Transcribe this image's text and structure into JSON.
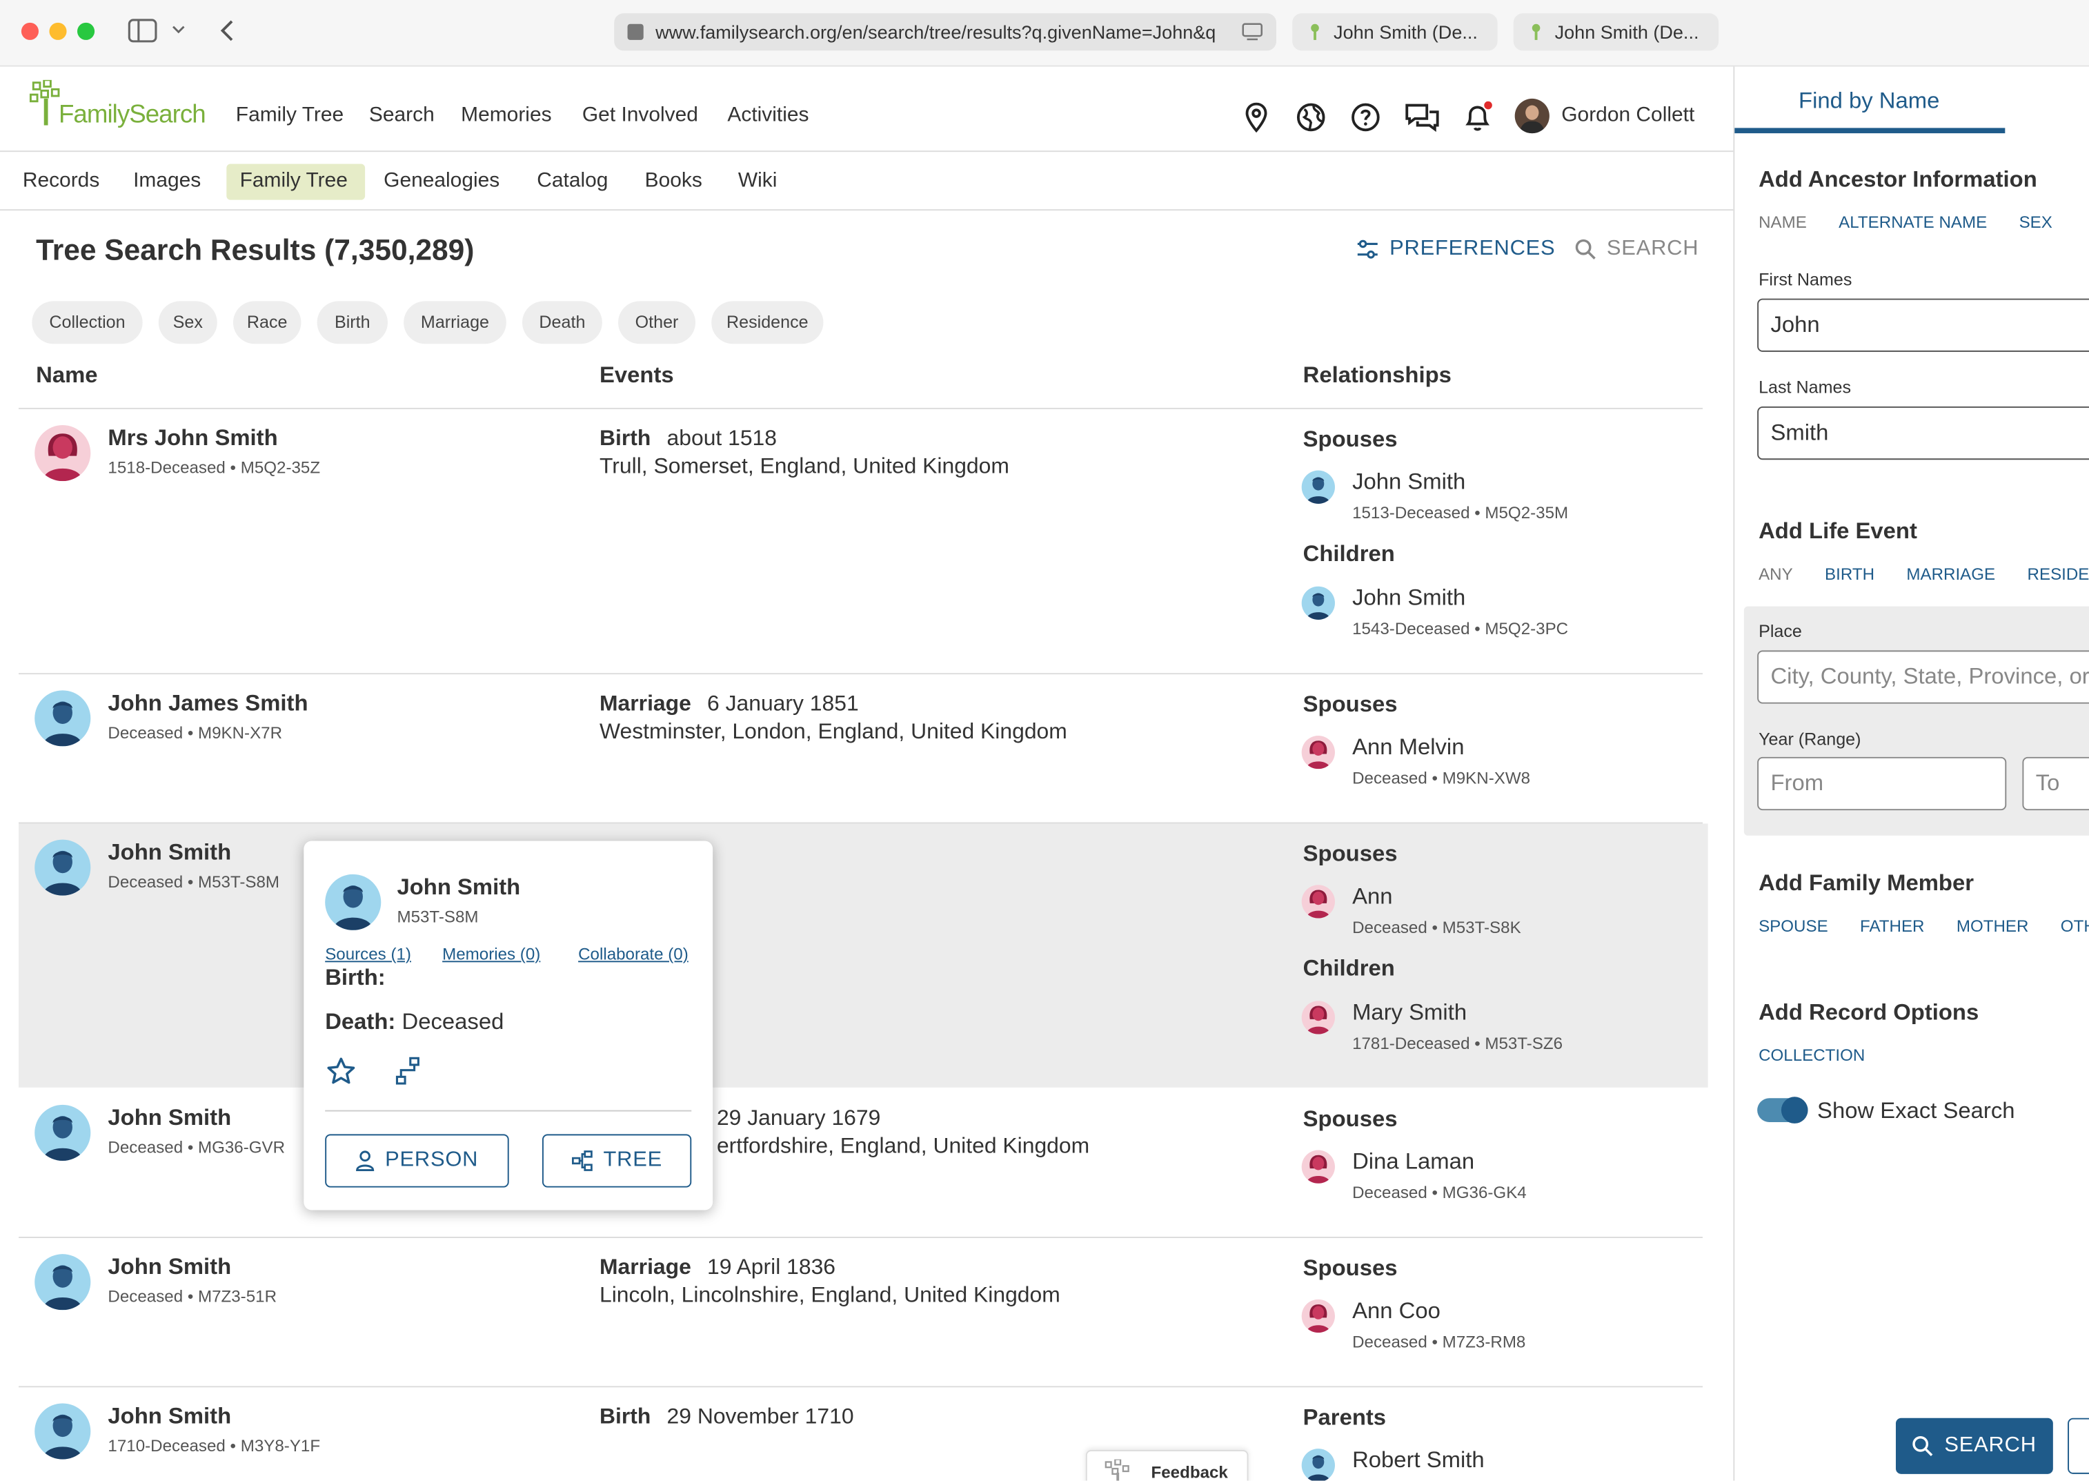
{
  "browser": {
    "url": "www.familysearch.org/en/search/tree/results?q.givenName=John&q",
    "tabs": [
      "John Smith (De...",
      "John Smith (De..."
    ]
  },
  "header": {
    "logo": "FamilySearch",
    "nav": [
      "Family Tree",
      "Search",
      "Memories",
      "Get Involved",
      "Activities"
    ],
    "user": "Gordon Collett"
  },
  "subnav": [
    "Records",
    "Images",
    "Family Tree",
    "Genealogies",
    "Catalog",
    "Books",
    "Wiki"
  ],
  "results": {
    "title": "Tree Search Results (7,350,289)",
    "preferences": "PREFERENCES",
    "search": "SEARCH",
    "filters": [
      "Collection",
      "Sex",
      "Race",
      "Birth",
      "Marriage",
      "Death",
      "Other",
      "Residence"
    ],
    "columns": {
      "name": "Name",
      "events": "Events",
      "relationships": "Relationships"
    },
    "rows": [
      {
        "name": "Mrs John Smith",
        "sub": "1518-Deceased • M5Q2-35Z",
        "event_type": "Birth",
        "event_date": "about 1518",
        "event_place": "Trull, Somerset, England, United Kingdom",
        "rel1_label": "Spouses",
        "rel1_name": "John Smith",
        "rel1_sub": "1513-Deceased • M5Q2-35M",
        "rel2_label": "Children",
        "rel2_name": "John Smith",
        "rel2_sub": "1543-Deceased • M5Q2-3PC"
      },
      {
        "name": "John James Smith",
        "sub": "Deceased • M9KN-X7R",
        "event_type": "Marriage",
        "event_date": "6 January 1851",
        "event_place": "Westminster, London, England, United Kingdom",
        "rel1_label": "Spouses",
        "rel1_name": "Ann Melvin",
        "rel1_sub": "Deceased • M9KN-XW8"
      },
      {
        "name": "John Smith",
        "sub": "Deceased • M53T-S8M",
        "rel1_label": "Spouses",
        "rel1_name": "Ann",
        "rel1_sub": "Deceased • M53T-S8K",
        "rel2_label": "Children",
        "rel2_name": "Mary Smith",
        "rel2_sub": "1781-Deceased • M53T-SZ6"
      },
      {
        "name": "John Smith",
        "sub": "Deceased • MG36-GVR",
        "event_date": "29 January 1679",
        "event_place": "ertfordshire, England, United Kingdom",
        "rel1_label": "Spouses",
        "rel1_name": "Dina Laman",
        "rel1_sub": "Deceased • MG36-GK4"
      },
      {
        "name": "John Smith",
        "sub": "Deceased • M7Z3-51R",
        "event_type": "Marriage",
        "event_date": "19 April 1836",
        "event_place": "Lincoln, Lincolnshire, England, United Kingdom",
        "rel1_label": "Spouses",
        "rel1_name": "Ann Coo",
        "rel1_sub": "Deceased • M7Z3-RM8"
      },
      {
        "name": "John Smith",
        "sub": "1710-Deceased • M3Y8-Y1F",
        "event_type": "Birth",
        "event_date": "29 November 1710",
        "rel1_label": "Parents",
        "rel1_name": "Robert Smith"
      }
    ]
  },
  "popup": {
    "name": "John Smith",
    "id": "M53T-S8M",
    "sources": "Sources (1)",
    "memories": "Memories (0)",
    "collaborate": "Collaborate (0)",
    "birth_label": "Birth:",
    "death_label": "Death:",
    "death_value": "Deceased",
    "person_btn": "PERSON",
    "tree_btn": "TREE"
  },
  "feedback": "Feedback",
  "sidebar": {
    "tab": "Find by Name",
    "ancestor_title": "Add Ancestor Information",
    "ancestor_tabs": [
      "NAME",
      "ALTERNATE NAME",
      "SEX"
    ],
    "first_label": "First Names",
    "first_value": "John",
    "last_label": "Last Names",
    "last_value": "Smith",
    "life_title": "Add Life Event",
    "life_tabs": [
      "ANY",
      "BIRTH",
      "MARRIAGE",
      "RESIDE"
    ],
    "place_label": "Place",
    "place_placeholder": "City, County, State, Province, or",
    "year_label": "Year (Range)",
    "from_placeholder": "From",
    "to_placeholder": "To",
    "family_title": "Add Family Member",
    "family_tabs": [
      "SPOUSE",
      "FATHER",
      "MOTHER",
      "OTH"
    ],
    "record_title": "Add Record Options",
    "record_tabs": [
      "COLLECTION"
    ],
    "exact_label": "Show Exact Search",
    "exact_on": true,
    "search_btn": "SEARCH"
  },
  "colors": {
    "accent": "#1f5b8a",
    "logo_green": "#7ab03c",
    "selected_row": "#ececec",
    "active_subnav": "#e6ecc8"
  }
}
